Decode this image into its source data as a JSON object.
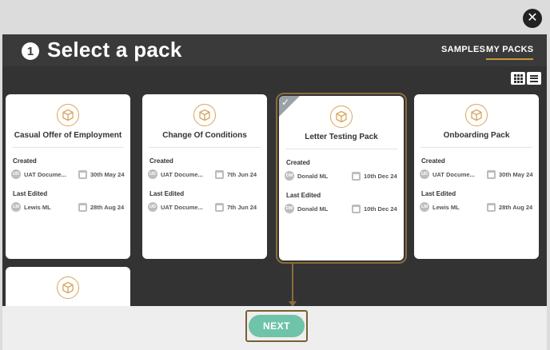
{
  "close": {
    "glyph": "✕"
  },
  "header": {
    "step_number": "1",
    "title": "Select a pack",
    "tabs": [
      {
        "label": "SAMPLES",
        "active": false
      },
      {
        "label": "MY PACKS",
        "active": true
      }
    ]
  },
  "view_toggles": {
    "grid_icon": "grid-view-icon",
    "list_icon": "list-view-icon"
  },
  "labels": {
    "created": "Created",
    "last_edited": "Last Edited"
  },
  "cards": [
    {
      "title": "Casual Offer of Employment",
      "created": {
        "initials": "UD",
        "user": "UAT Docume...",
        "date": "30th May 24"
      },
      "edited": {
        "initials": "LM",
        "user": "Lewis ML",
        "date": "28th Aug 24"
      }
    },
    {
      "title": "Change Of Conditions",
      "created": {
        "initials": "UD",
        "user": "UAT Docume...",
        "date": "7th Jun 24"
      },
      "edited": {
        "initials": "UD",
        "user": "UAT Docume...",
        "date": "7th Jun 24"
      }
    },
    {
      "title": "Letter Testing Pack",
      "selected": true,
      "created": {
        "initials": "DM",
        "user": "Donald ML",
        "date": "10th Dec 24"
      },
      "edited": {
        "initials": "DM",
        "user": "Donald ML",
        "date": "10th Dec 24"
      }
    },
    {
      "title": "Onboarding Pack",
      "created": {
        "initials": "UD",
        "user": "UAT Docume...",
        "date": "30th May 24"
      },
      "edited": {
        "initials": "LM",
        "user": "Lewis ML",
        "date": "28th Aug 24"
      }
    }
  ],
  "footer": {
    "next_label": "NEXT"
  },
  "colors": {
    "accent": "#c8963e",
    "next_button": "#6fc3a9",
    "modal_bg": "#333333"
  }
}
